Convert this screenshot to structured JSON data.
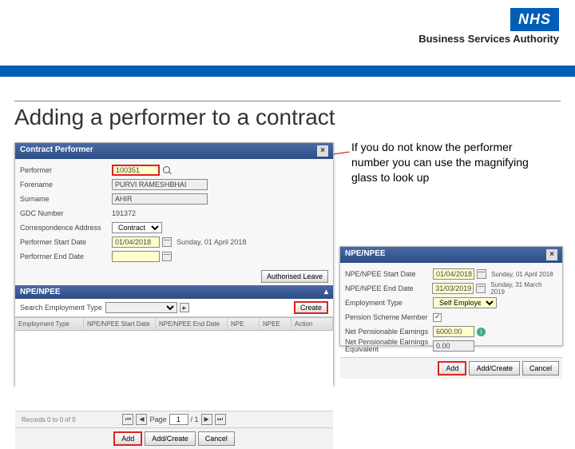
{
  "logo": {
    "nhs": "NHS",
    "bsa": "Business Services Authority"
  },
  "title": "Adding a performer to a contract",
  "info_text": "If you do not know the performer number you can use the magnifying glass to look up",
  "dialog1": {
    "title": "Contract Performer",
    "labels": {
      "performer": "Performer",
      "forename": "Forename",
      "surname": "Surname",
      "gdc": "GDC Number",
      "corr": "Correspondence Address",
      "start": "Performer Start Date",
      "end": "Performer End Date"
    },
    "values": {
      "performer": "100351",
      "forename": "PURVI RAMESHBHAI",
      "surname": "AHIR",
      "gdc": "191372",
      "corr": "Contract",
      "start": "01/04/2018",
      "start_disp": "Sunday, 01 April 2018"
    },
    "auth_btn": "Authorised Leave",
    "sub_title": "NPE/NPEE",
    "search_lbl": "Search Employment Type",
    "create_btn": "Create",
    "grid_cols": [
      "Employment Type",
      "NPE/NPEE Start Date",
      "NPE/NPEE End Date",
      "NPE",
      "NPEE",
      "Action"
    ],
    "records": "Records 0 to 0 of 0",
    "page_lbl": "Page",
    "page_val": "1",
    "page_of": "/ 1",
    "buttons": {
      "add": "Add",
      "addcreate": "Add/Create",
      "cancel": "Cancel"
    }
  },
  "dialog2": {
    "title": "NPE/NPEE",
    "labels": {
      "start": "NPE/NPEE Start Date",
      "end": "NPE/NPEE End Date",
      "emp": "Employment Type",
      "psm": "Pension Scheme Member",
      "npe": "Net Pensionable Earnings",
      "npee": "Net Pensionable Earnings Equivalent"
    },
    "values": {
      "start": "01/04/2018",
      "start_disp": "Sunday, 01 April 2018",
      "end": "31/03/2019",
      "end_disp": "Sunday, 31 March 2019",
      "emp": "Self Employed",
      "npe": "6000.00",
      "npee": "0.00"
    },
    "buttons": {
      "add": "Add",
      "addcreate": "Add/Create",
      "cancel": "Cancel"
    }
  }
}
